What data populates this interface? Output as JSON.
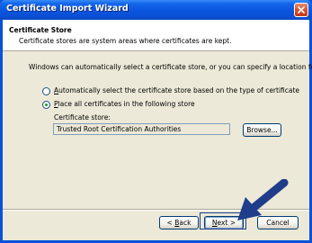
{
  "window": {
    "title": "Certificate Import Wizard"
  },
  "header": {
    "title": "Certificate Store",
    "description": "Certificate stores are system areas where certificates are kept."
  },
  "body": {
    "intro": "Windows can automatically select a certificate store, or you can specify a location for",
    "options": [
      {
        "label_mnemonic": "A",
        "label_rest": "utomatically select the certificate store based on the type of certificate",
        "selected": false
      },
      {
        "label_mnemonic": "P",
        "label_rest": "lace all certificates in the following store",
        "selected": true
      }
    ],
    "store_label": "Certificate store:",
    "store_value": "Trusted Root Certification Authorities",
    "browse_label": "Browse..."
  },
  "footer": {
    "back_pre": "< ",
    "back_mnemonic": "B",
    "back_rest": "ack",
    "next_mnemonic": "N",
    "next_rest": "ext >",
    "cancel_label": "Cancel"
  },
  "colors": {
    "titlebar": "#0a55e0",
    "dialog_face": "#ece9d8",
    "arrow": "#1f3d8a",
    "close_button": "#d5512f"
  },
  "icons": [
    "close-icon",
    "pointer-arrow-icon"
  ]
}
